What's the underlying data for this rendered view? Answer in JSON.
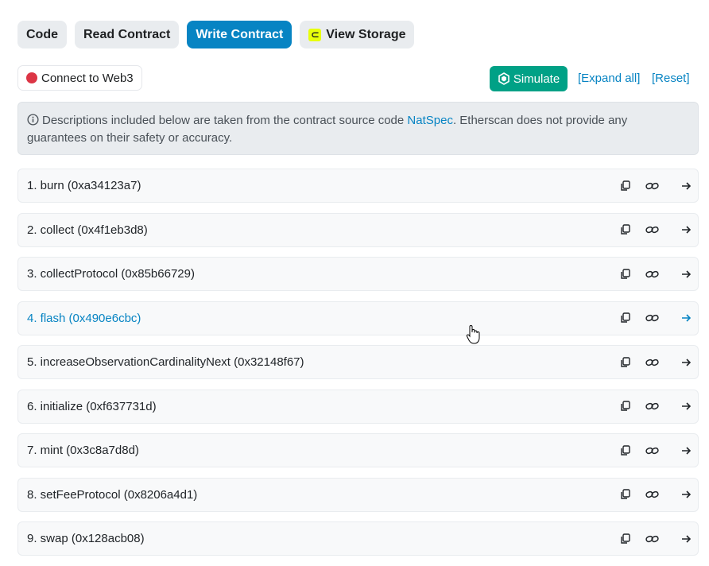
{
  "tabs": [
    {
      "label": "Code"
    },
    {
      "label": "Read Contract"
    },
    {
      "label": "Write Contract"
    },
    {
      "label": "View Storage"
    }
  ],
  "toolbar": {
    "connect_label": "Connect to Web3",
    "simulate_label": "Simulate",
    "expand_label": "[Expand all]",
    "reset_label": "[Reset]"
  },
  "info": {
    "text_before": "Descriptions included below are taken from the contract source code ",
    "link": "NatSpec",
    "text_after": ". Etherscan does not provide any guarantees on their safety or accuracy."
  },
  "functions": [
    {
      "label": "1. burn (0xa34123a7)"
    },
    {
      "label": "2. collect (0x4f1eb3d8)"
    },
    {
      "label": "3. collectProtocol (0x85b66729)"
    },
    {
      "label": "4. flash (0x490e6cbc)"
    },
    {
      "label": "5. increaseObservationCardinalityNext (0x32148f67)"
    },
    {
      "label": "6. initialize (0xf637731d)"
    },
    {
      "label": "7. mint (0x3c8a7d8d)"
    },
    {
      "label": "8. setFeeProtocol (0x8206a4d1)"
    },
    {
      "label": "9. swap (0x128acb08)"
    }
  ],
  "colors": {
    "accent": "#0784c3",
    "simulate": "#00a186",
    "connect_dot": "#dc3545",
    "storage_icon": "#e8ff0a"
  }
}
